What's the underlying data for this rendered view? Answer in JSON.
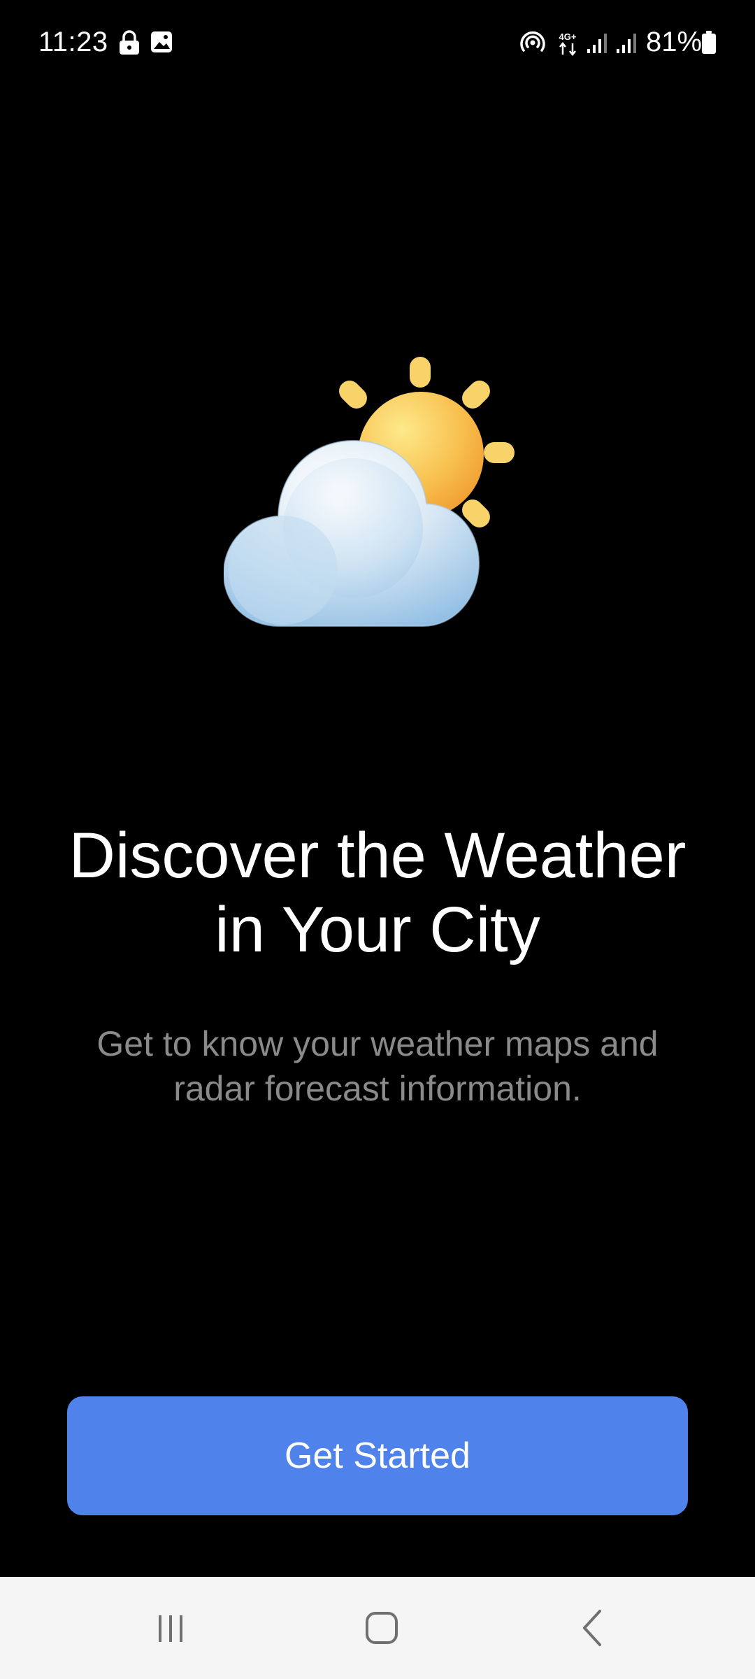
{
  "status_bar": {
    "time": "11:23",
    "battery_percent": "81%",
    "icons": [
      "lock-icon",
      "image-notification-icon",
      "hotspot-icon",
      "data-4g-plus-icon",
      "signal-icon",
      "signal-icon",
      "battery-icon"
    ],
    "data_label": "4G+"
  },
  "illustration": {
    "icon": "partly-cloudy-icon",
    "colors": {
      "sun": "#f5a93a",
      "sun_rays": "#f7d36a",
      "cloud": "#b9d7ee"
    }
  },
  "onboarding": {
    "headline_line1": "Discover the Weather",
    "headline_line2": "in Your City",
    "subtitle_line1": "Get to know your weather maps and",
    "subtitle_line2": "radar forecast information.",
    "cta_label": "Get Started"
  },
  "nav_bar": {
    "buttons": [
      "recent-apps-icon",
      "home-icon",
      "back-icon"
    ]
  },
  "colors": {
    "background": "#000000",
    "button": "#4f82eb",
    "subtitle": "#8a8a8a",
    "nav_bar": "#f5f5f5"
  }
}
